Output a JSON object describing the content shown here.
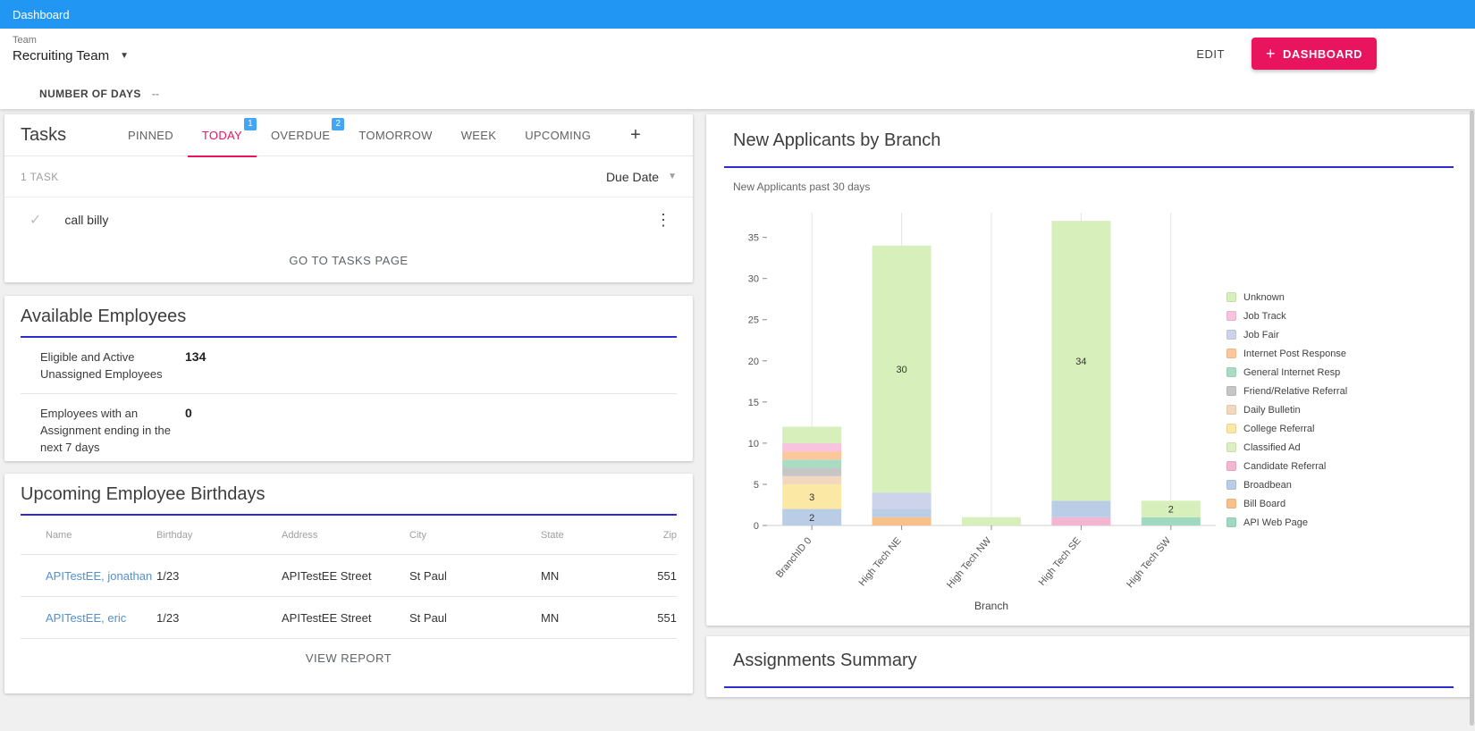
{
  "topbar": {
    "title": "Dashboard"
  },
  "header": {
    "team_label": "Team",
    "team_value": "Recruiting Team",
    "edit_label": "EDIT",
    "add_dashboard_label": "DASHBOARD"
  },
  "filter_bar": {
    "label": "NUMBER OF DAYS",
    "value": "--"
  },
  "tasks": {
    "title": "Tasks",
    "tabs": [
      {
        "label": "PINNED"
      },
      {
        "label": "TODAY",
        "badge": "1",
        "active": true
      },
      {
        "label": "OVERDUE",
        "badge": "2"
      },
      {
        "label": "TOMORROW"
      },
      {
        "label": "WEEK"
      },
      {
        "label": "UPCOMING"
      }
    ],
    "add_tab_label": "+",
    "count_label": "1 TASK",
    "sort_label": "Due Date",
    "items": [
      {
        "title": "call billy"
      }
    ],
    "footer_link": "GO TO TASKS PAGE"
  },
  "available_employees": {
    "title": "Available Employees",
    "rows": [
      {
        "label": "Eligible and Active Unassigned Employees",
        "value": "134"
      },
      {
        "label": "Employees with an Assignment ending in the next 7 days",
        "value": "0"
      }
    ]
  },
  "birthdays": {
    "title": "Upcoming Employee Birthdays",
    "columns": [
      "Name",
      "Birthday",
      "Address",
      "City",
      "State",
      "Zip"
    ],
    "rows": [
      {
        "name": "APITestEE, jonathan",
        "birthday": "1/23",
        "address": "APITestEE Street",
        "city": "St Paul",
        "state": "MN",
        "zip": "551"
      },
      {
        "name": "APITestEE, eric",
        "birthday": "1/23",
        "address": "APITestEE Street",
        "city": "St Paul",
        "state": "MN",
        "zip": "551"
      }
    ],
    "footer_link": "VIEW REPORT"
  },
  "chart_data": {
    "type": "bar",
    "stacked": true,
    "title": "New Applicants by Branch",
    "subtitle": "New Applicants past 30 days",
    "xlabel": "Branch",
    "ylabel": "",
    "ylim": [
      0,
      38
    ],
    "yticks": [
      0,
      5,
      10,
      15,
      20,
      25,
      30,
      35
    ],
    "grid": "vertical",
    "legend_position": "right",
    "categories": [
      "BranchID 0",
      "High Tech NE",
      "High Tech NW",
      "High Tech SE",
      "High Tech SW"
    ],
    "legend": [
      {
        "name": "Unknown",
        "color": "#d6efbb"
      },
      {
        "name": "Job Track",
        "color": "#f8c3de"
      },
      {
        "name": "Job Fair",
        "color": "#ccd3ea"
      },
      {
        "name": "Internet Post Response",
        "color": "#fbc79b"
      },
      {
        "name": "General Internet Resp",
        "color": "#aadcc3"
      },
      {
        "name": "Friend/Relative Referral",
        "color": "#c6c6c6"
      },
      {
        "name": "Daily Bulletin",
        "color": "#f2d8bf"
      },
      {
        "name": "College Referral",
        "color": "#fae8a4"
      },
      {
        "name": "Classified Ad",
        "color": "#dcefc0"
      },
      {
        "name": "Candidate Referral",
        "color": "#f4b5d0"
      },
      {
        "name": "Broadbean",
        "color": "#b9cde6"
      },
      {
        "name": "Bill Board",
        "color": "#f9c089"
      },
      {
        "name": "API Web Page",
        "color": "#9ed9c0"
      }
    ],
    "bars": [
      {
        "category": "BranchID 0",
        "total": 12,
        "segments": [
          {
            "name": "Broadbean",
            "value": 2,
            "label": "2"
          },
          {
            "name": "College Referral",
            "value": 3,
            "label": "3"
          },
          {
            "name": "Daily Bulletin",
            "value": 1
          },
          {
            "name": "Friend/Relative Referral",
            "value": 1
          },
          {
            "name": "General Internet Resp",
            "value": 1
          },
          {
            "name": "Internet Post Response",
            "value": 1
          },
          {
            "name": "Job Track",
            "value": 1
          },
          {
            "name": "Unknown",
            "value": 2
          }
        ]
      },
      {
        "category": "High Tech NE",
        "total": 34,
        "segments": [
          {
            "name": "Bill Board",
            "value": 1
          },
          {
            "name": "Broadbean",
            "value": 1
          },
          {
            "name": "Job Fair",
            "value": 2
          },
          {
            "name": "Unknown",
            "value": 30,
            "label": "30"
          }
        ]
      },
      {
        "category": "High Tech NW",
        "total": 1,
        "segments": [
          {
            "name": "Unknown",
            "value": 1
          }
        ]
      },
      {
        "category": "High Tech SE",
        "total": 37,
        "segments": [
          {
            "name": "Candidate Referral",
            "value": 1
          },
          {
            "name": "Broadbean",
            "value": 2
          },
          {
            "name": "Unknown",
            "value": 34,
            "label": "34"
          }
        ]
      },
      {
        "category": "High Tech SW",
        "total": 3,
        "segments": [
          {
            "name": "API Web Page",
            "value": 1
          },
          {
            "name": "Unknown",
            "value": 2,
            "label": "2"
          }
        ]
      }
    ]
  },
  "assignments": {
    "title": "Assignments Summary"
  },
  "colors": {
    "topbar_blue": "#2196f3",
    "accent_pink": "#e8145e",
    "divider_blue": "#2d2dcf",
    "badge_blue": "#42a5f5",
    "link_blue": "#5590cb"
  }
}
